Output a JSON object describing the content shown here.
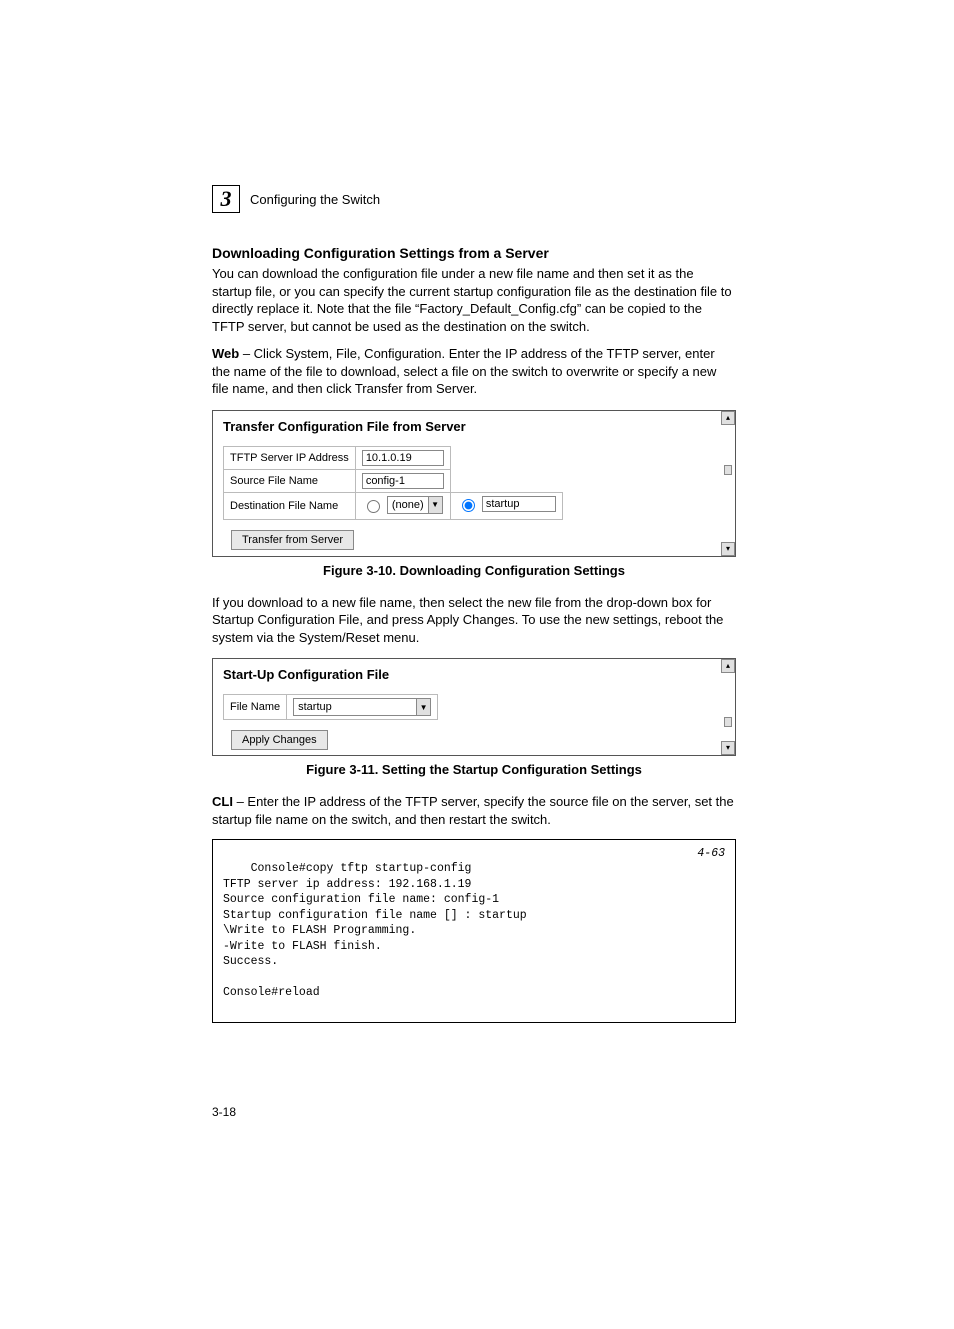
{
  "chapter": {
    "number": "3",
    "label": "Configuring the Switch"
  },
  "section": {
    "title": "Downloading Configuration Settings from a Server",
    "para1": "You can download the configuration file under a new file name and then set it as the startup file, or you can specify the current startup configuration file as the destination file to directly replace it. Note that the file “Factory_Default_Config.cfg” can be copied to the TFTP server, but cannot be used as the destination on the switch.",
    "web_lead": "Web",
    "web_text": " – Click System, File, Configuration. Enter the IP address of the TFTP server, enter the name of the file to download, select a file on the switch to overwrite or specify a new file name, and then click Transfer from Server."
  },
  "fig10": {
    "panel_title": "Transfer Configuration File from Server",
    "row1_label": "TFTP Server IP Address",
    "row1_value": "10.1.0.19",
    "row2_label": "Source File Name",
    "row2_value": "config-1",
    "row3_label": "Destination File Name",
    "row3_none": "(none)",
    "row3_startup": "startup",
    "button": "Transfer from Server",
    "caption": "Figure 3-10.  Downloading Configuration Settings"
  },
  "mid_para": "If you download to a new file name, then select the new file from the drop-down box for Startup Configuration File, and press Apply Changes. To use the new settings, reboot the system via the System/Reset menu.",
  "fig11": {
    "panel_title": "Start-Up Configuration File",
    "row1_label": "File Name",
    "row1_value": "startup",
    "button": "Apply Changes",
    "caption": "Figure 3-11.  Setting the Startup Configuration Settings"
  },
  "cli": {
    "lead": "CLI",
    "text": " – Enter the IP address of the TFTP server, specify the source file on the server, set the startup file name on the switch, and then restart the switch.",
    "ref": "4-63",
    "lines": "Console#copy tftp startup-config\nTFTP server ip address: 192.168.1.19\nSource configuration file name: config-1\nStartup configuration file name [] : startup\n\\Write to FLASH Programming.\n-Write to FLASH finish.\nSuccess.\n\nConsole#reload"
  },
  "page_number": "3-18"
}
